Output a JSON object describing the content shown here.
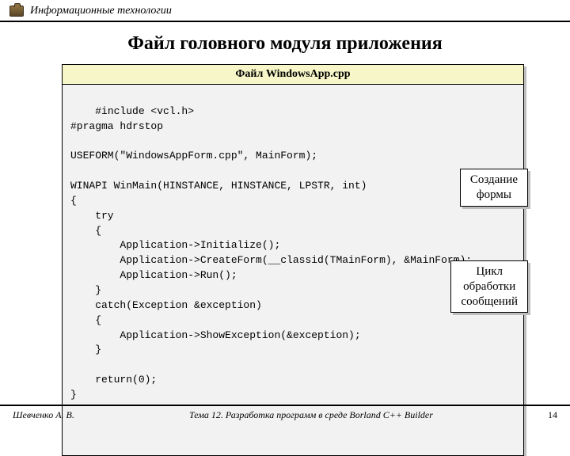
{
  "header": {
    "course_title": "Информационные технологии"
  },
  "main": {
    "title": "Файл головного модуля приложения",
    "code_caption": "Файл WindowsApp.cpp",
    "code": "#include <vcl.h>\n#pragma hdrstop\n\nUSEFORM(\"WindowsAppForm.cpp\", MainForm);\n\nWINAPI WinMain(HINSTANCE, HINSTANCE, LPSTR, int)\n{\n    try\n    {\n        Application->Initialize();\n        Application->CreateForm(__classid(TMainForm), &MainForm);\n        Application->Run();\n    }\n    catch(Exception &exception)\n    {\n        Application->ShowException(&exception);\n    }\n\n    return(0);\n}",
    "annotations": {
      "a1": "Создание\nформы",
      "a2": "Цикл\nобработки\nсообщений"
    }
  },
  "footer": {
    "author": "Шевченко А. В.",
    "topic": "Тема 12. Разработка программ в среде Borland C++ Builder",
    "page": "14"
  }
}
